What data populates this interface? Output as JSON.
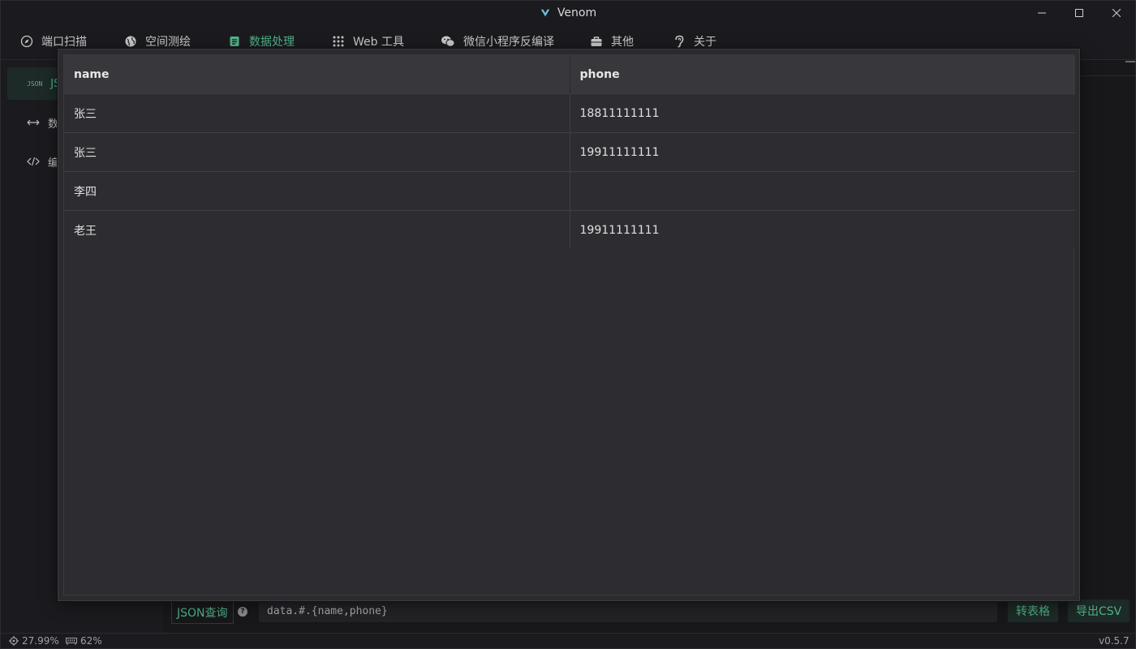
{
  "window": {
    "title": "Venom"
  },
  "nav": {
    "tabs": [
      {
        "label": "端口扫描",
        "icon": "compass-icon",
        "active": false
      },
      {
        "label": "空间测绘",
        "icon": "globe-icon",
        "active": false
      },
      {
        "label": "数据处理",
        "icon": "document-icon",
        "active": true
      },
      {
        "label": "Web 工具",
        "icon": "grid-dots-icon",
        "active": false
      },
      {
        "label": "微信小程序反编译",
        "icon": "wechat-icon",
        "active": false
      },
      {
        "label": "其他",
        "icon": "briefcase-icon",
        "active": false
      },
      {
        "label": "关于",
        "icon": "ear-icon",
        "active": false
      }
    ]
  },
  "sidebar": {
    "items": [
      {
        "tag": "JSON",
        "label": "JS",
        "icon": "json-icon",
        "active": true
      },
      {
        "label": "数",
        "icon": "arrows-horizontal-icon",
        "active": false
      },
      {
        "label": "编",
        "icon": "code-icon",
        "active": false
      }
    ]
  },
  "modal": {
    "columns": [
      "name",
      "phone"
    ],
    "rows": [
      [
        "张三",
        "18811111111"
      ],
      [
        "张三",
        "19911111111"
      ],
      [
        "李四",
        ""
      ],
      [
        "老王",
        "19911111111"
      ]
    ]
  },
  "query": {
    "label": "JSON查询",
    "help": "?",
    "value": "data.#.{name,phone}",
    "to_table_label": "转表格",
    "export_csv_label": "导出CSV"
  },
  "status": {
    "cpu": "27.99%",
    "memory": "62%",
    "version": "v0.5.7"
  },
  "colors": {
    "accent": "#4fb389",
    "background": "#18181b",
    "modal": "#2d2c31",
    "header": "#38373c"
  }
}
